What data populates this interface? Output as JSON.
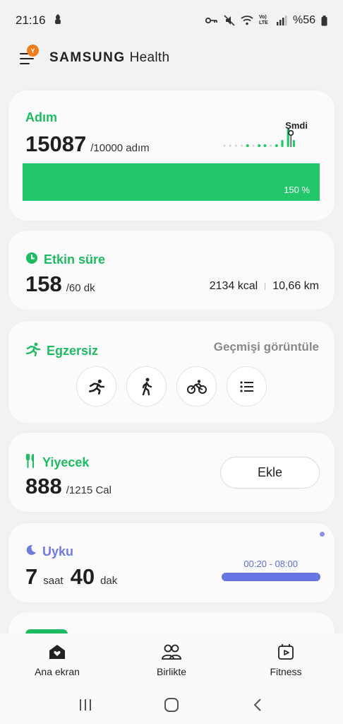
{
  "status": {
    "time": "21:16",
    "battery": "%56",
    "volte": "Vo) LTE"
  },
  "header": {
    "brand": "SAMSUNG",
    "product": "Health",
    "badge": "Y"
  },
  "steps": {
    "title": "Adım",
    "value": "15087",
    "goal": "/10000 adım",
    "now_label": "Şmdi",
    "percent": "150 %",
    "progress_fraction": 1.5,
    "hourly_markers": [
      "low",
      "low",
      "low",
      "low",
      "mid",
      "low",
      "mid",
      "mid",
      "low",
      "mid",
      "high",
      "peak",
      "high"
    ]
  },
  "active": {
    "title": "Etkin süre",
    "value": "158",
    "goal": "/60 dk",
    "kcal": "2134 kcal",
    "distance": "10,66 km"
  },
  "exercise": {
    "title": "Egzersiz",
    "history_link": "Geçmişi görüntüle",
    "buttons": [
      "running-icon",
      "walking-icon",
      "cycling-icon",
      "list-icon"
    ]
  },
  "food": {
    "title": "Yiyecek",
    "value": "888",
    "goal": "/1215 Cal",
    "add_label": "Ekle"
  },
  "sleep": {
    "title": "Uyku",
    "hours": "7",
    "hours_unit": "saat",
    "minutes": "40",
    "minutes_unit": "dak",
    "range": "00:20 - 08:00"
  },
  "bottom_nav": {
    "home": "Ana ekran",
    "together": "Birlikte",
    "fitness": "Fitness"
  },
  "colors": {
    "accent_green": "#22c76a",
    "sleep_blue": "#6875e0",
    "badge_orange": "#f07c1c"
  }
}
